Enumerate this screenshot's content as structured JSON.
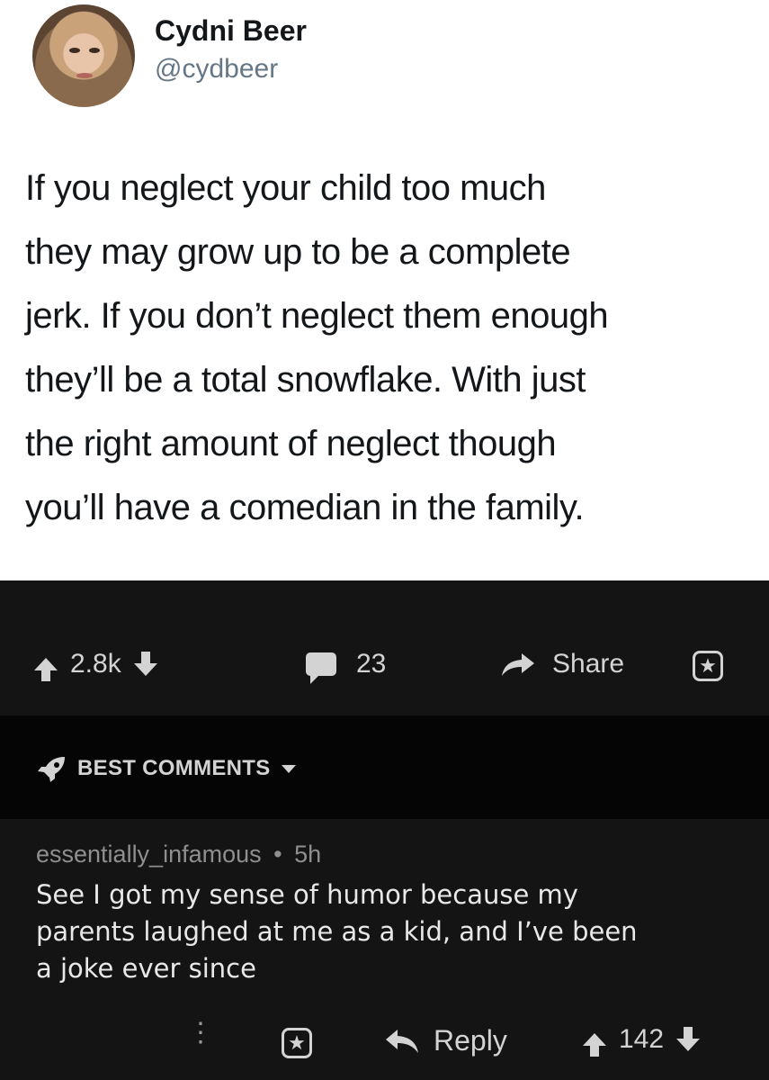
{
  "tweet": {
    "display_name": "Cydni Beer",
    "handle": "@cydbeer",
    "text": "If you neglect your child too much\nthey may grow up to be a complete\njerk. If you don’t neglect them enough\nthey’ll be a total snowflake. With just\nthe right amount of neglect though\nyou’ll have a comedian in the family."
  },
  "post_actions": {
    "score": "2.8k",
    "comment_count": "23",
    "share_label": "Share"
  },
  "sort": {
    "label": "BEST COMMENTS"
  },
  "comment": {
    "author": "essentially_infamous",
    "separator": "•",
    "age": "5h",
    "body": "See I got my sense of humor because my\nparents laughed at me as a kid, and I’ve been\na joke ever since",
    "reply_label": "Reply",
    "score": "142",
    "more_label": "⋮"
  },
  "icons": {
    "upvote": "arrow-up-icon",
    "downvote": "arrow-down-icon",
    "comments": "chat-bubble-icon",
    "share": "share-arrow-icon",
    "award": "award-icon",
    "sort": "rocket-icon",
    "reply": "reply-arrow-icon",
    "more": "more-options-icon"
  },
  "colors": {
    "tweet_bg": "#ffffff",
    "dark_bg": "#141414",
    "sort_bg": "#050505",
    "text_light": "#d3d3d3",
    "meta_gray": "#8f8f8f"
  }
}
